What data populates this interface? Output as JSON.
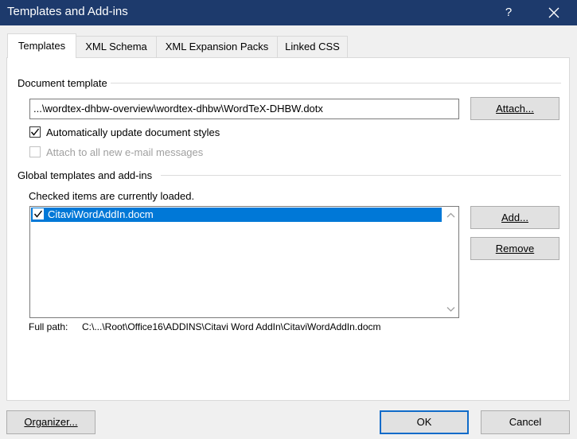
{
  "window": {
    "title": "Templates and Add-ins",
    "help_label": "?"
  },
  "tabs": [
    {
      "label": "Templates",
      "active": true
    },
    {
      "label": "XML Schema",
      "active": false
    },
    {
      "label": "XML Expansion Packs",
      "active": false
    },
    {
      "label": "Linked CSS",
      "active": false
    }
  ],
  "document_template": {
    "group_label": "Document template",
    "path_value": "...\\wordtex-dhbw-overview\\wordtex-dhbw\\WordTeX-DHBW.dotx",
    "attach_label": "Attach...",
    "auto_update_label": "Automatically update document styles",
    "auto_update_checked": true,
    "attach_email_label": "Attach to all new e-mail messages",
    "attach_email_checked": false,
    "attach_email_enabled": false
  },
  "global_templates": {
    "group_label": "Global templates and add-ins",
    "hint": "Checked items are currently loaded.",
    "items": [
      {
        "name": "CitaviWordAddIn.docm",
        "checked": true,
        "selected": true
      }
    ],
    "add_label": "Add...",
    "remove_label": "Remove",
    "full_path_label": "Full path:",
    "full_path_value": "C:\\...\\Root\\Office16\\ADDINS\\Citavi Word AddIn\\CitaviWordAddIn.docm"
  },
  "footer": {
    "organizer_label": "Organizer...",
    "ok_label": "OK",
    "cancel_label": "Cancel"
  },
  "colors": {
    "titlebar": "#1d3a6c",
    "selection": "#0078d7",
    "default_button_border": "#0f6bc9"
  }
}
